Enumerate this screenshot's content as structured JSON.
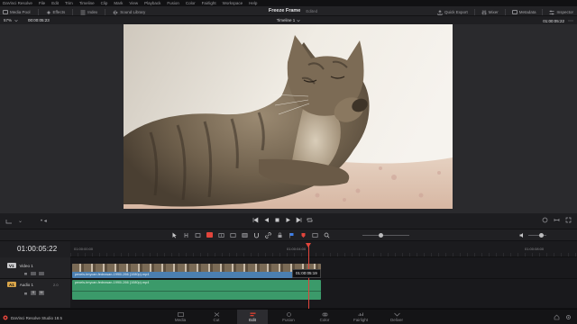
{
  "app": {
    "name": "DaVinci Resolve",
    "menus": [
      "DaVinci Resolve",
      "File",
      "Edit",
      "Trim",
      "Timeline",
      "Clip",
      "Mark",
      "View",
      "Playback",
      "Fusion",
      "Color",
      "Fairlight",
      "Workspace",
      "Help"
    ]
  },
  "toolbar": {
    "left": [
      {
        "label": "Media Pool",
        "icon": "media-pool-icon"
      },
      {
        "label": "Effects",
        "icon": "effects-icon"
      },
      {
        "label": "Index",
        "icon": "index-icon"
      },
      {
        "label": "Sound Library",
        "icon": "sound-library-icon"
      }
    ],
    "project_title": "Freeze Frame",
    "project_status": "Edited",
    "right": [
      {
        "label": "Quick Export",
        "icon": "export-icon"
      },
      {
        "label": "Mixer",
        "icon": "mixer-icon"
      },
      {
        "label": "Metadata",
        "icon": "metadata-icon"
      },
      {
        "label": "Inspector",
        "icon": "inspector-icon"
      }
    ]
  },
  "viewer": {
    "zoom": "57%",
    "source_timecode": "00:00:05:23",
    "timeline_name": "Timeline 1",
    "record_timecode": "01:00:05:22"
  },
  "timeline": {
    "current_timecode": "01:00:05:22",
    "ruler_labels": [
      "01:00:00:00",
      "01:00:04:00",
      "01:00:08:00"
    ],
    "playhead_tooltip": "01:00:05:19",
    "tracks": [
      {
        "id": "V1",
        "name": "Video 1",
        "kind": "video",
        "color": "#c9c9cc"
      },
      {
        "id": "A1",
        "name": "Audio 1",
        "kind": "audio",
        "color": "#d9a54a",
        "channel": "2.0"
      }
    ],
    "clip_name": "pexels-tmycan-fedrowan-1990/-266 (1080p).mp4",
    "audio_clip_name": "pexels-tmycan-fedrowan-1990/-266 (1080p).mp4"
  },
  "pages": [
    {
      "label": "Media",
      "icon": "media-page-icon"
    },
    {
      "label": "Cut",
      "icon": "cut-page-icon"
    },
    {
      "label": "Edit",
      "icon": "edit-page-icon",
      "active": true
    },
    {
      "label": "Fusion",
      "icon": "fusion-page-icon"
    },
    {
      "label": "Color",
      "icon": "color-page-icon"
    },
    {
      "label": "Fairlight",
      "icon": "fairlight-page-icon"
    },
    {
      "label": "Deliver",
      "icon": "deliver-page-icon"
    }
  ],
  "status": {
    "version": "DaVinci Resolve Studio 18.5"
  },
  "colors": {
    "accent_red": "#e2453c",
    "video_clip": "#4b7fb0",
    "audio_clip": "#3b9a6a",
    "active_page": "#e04030"
  }
}
